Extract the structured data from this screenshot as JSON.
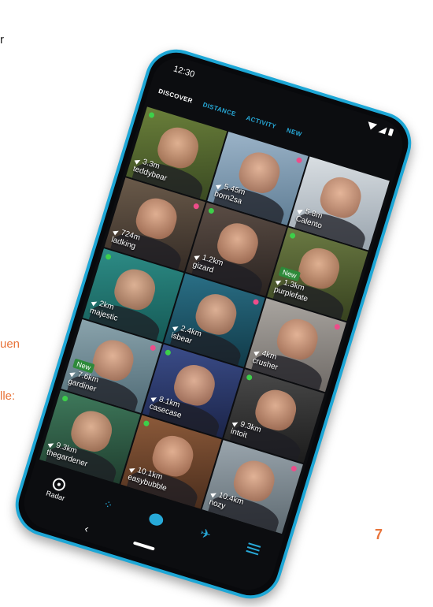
{
  "side": {
    "top_fragment": "r",
    "orange_line_1": "uen",
    "orange_line_2": "lle:",
    "page_number": "7"
  },
  "status": {
    "time": "12:30"
  },
  "tabs": [
    "DISCOVER",
    "DISTANCE",
    "ACTIVITY",
    "NEW"
  ],
  "profiles": [
    {
      "name": "teddybear",
      "distance": "3.3m"
    },
    {
      "name": "born2sa",
      "distance": "5.45m"
    },
    {
      "name": "Calento",
      "distance": "5.8m"
    },
    {
      "name": "ladking",
      "distance": "724m"
    },
    {
      "name": "gizard",
      "distance": "1.2km"
    },
    {
      "name": "purplefate",
      "distance": "1.3km",
      "badge": "New"
    },
    {
      "name": "majestic",
      "distance": "2km"
    },
    {
      "name": "isbear",
      "distance": "2.4km"
    },
    {
      "name": "crusher",
      "distance": "4km"
    },
    {
      "name": "gardiner",
      "distance": "7.6km",
      "badge": "New"
    },
    {
      "name": "casecase",
      "distance": "8.1km"
    },
    {
      "name": "intoit",
      "distance": "9.3km"
    },
    {
      "name": "thegardener",
      "distance": "9.3km"
    },
    {
      "name": "easybubble",
      "distance": "10.1km"
    },
    {
      "name": "nozy",
      "distance": "10.4km"
    }
  ],
  "bottom_nav": {
    "radar_label": "Radar"
  },
  "colors": {
    "accent": "#27a9d8",
    "online": "#3dd04a",
    "badge_new": "#2e8a3a",
    "frame": "#1da7d6",
    "side_text": "#e8743b"
  }
}
